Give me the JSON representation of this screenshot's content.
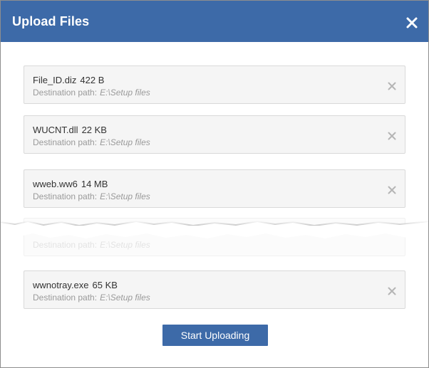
{
  "dialog": {
    "title": "Upload Files",
    "close_icon": "close-icon"
  },
  "files": [
    {
      "name": "File_ID.diz",
      "size": "422 B",
      "dest_label": "Destination path:",
      "dest_value": "E:\\Setup files"
    },
    {
      "name": "WUCNT.dll",
      "size": "22 KB",
      "dest_label": "Destination path:",
      "dest_value": "E:\\Setup files"
    },
    {
      "name": "wweb.ww6",
      "size": "14 MB",
      "dest_label": "Destination path:",
      "dest_value": "E:\\Setup files"
    },
    {
      "name": "",
      "size": "",
      "dest_label": "Destination path:",
      "dest_value": "E:\\Setup files"
    },
    {
      "name": "wwnotray.exe",
      "size": "65 KB",
      "dest_label": "Destination path:",
      "dest_value": "E:\\Setup files"
    }
  ],
  "actions": {
    "start_label": "Start Uploading"
  },
  "colors": {
    "header": "#3d6aa8",
    "button": "#3d6aa8",
    "row_bg": "#f5f5f5"
  }
}
